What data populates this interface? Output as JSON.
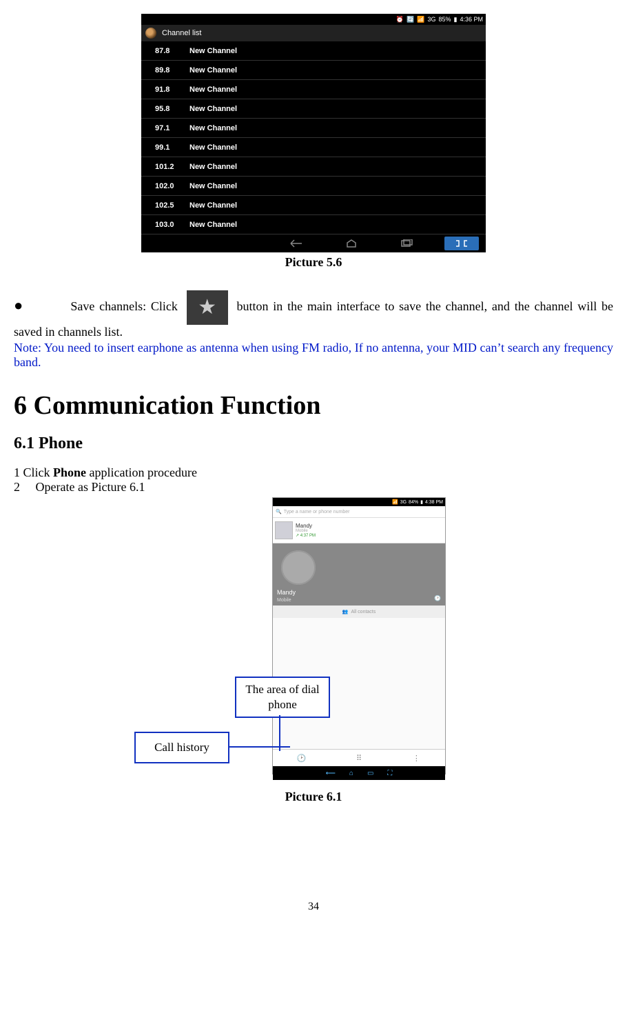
{
  "screenshot56": {
    "status": {
      "net": "3G",
      "battery": "85%",
      "time": "4:36 PM"
    },
    "title": "Channel list",
    "channels": [
      {
        "freq": "87.8",
        "name": "New Channel"
      },
      {
        "freq": "89.8",
        "name": "New Channel"
      },
      {
        "freq": "91.8",
        "name": "New Channel"
      },
      {
        "freq": "95.8",
        "name": "New Channel"
      },
      {
        "freq": "97.1",
        "name": "New Channel"
      },
      {
        "freq": "99.1",
        "name": "New Channel"
      },
      {
        "freq": "101.2",
        "name": "New Channel"
      },
      {
        "freq": "102.0",
        "name": "New Channel"
      },
      {
        "freq": "102.5",
        "name": "New Channel"
      },
      {
        "freq": "103.0",
        "name": "New Channel"
      }
    ]
  },
  "captions": {
    "p56": "Picture 5.6",
    "p61": "Picture 6.1"
  },
  "body": {
    "save_pre": "Save channels: Click ",
    "save_post": " button in the main interface to save the channel, and the channel will be saved in channels list.",
    "note": "Note: You need to insert earphone as antenna when using FM radio, If no antenna, your MID can’t search any frequency band."
  },
  "headings": {
    "h1": "6 Communication Function",
    "h2": "6.1 Phone"
  },
  "steps": {
    "s1_pre": "1 Click ",
    "s1_bold": "Phone",
    "s1_post": " application procedure",
    "s2": "2     Operate as Picture 6.1"
  },
  "pic61": {
    "status": {
      "net": "3G",
      "battery": "84%",
      "time": "4:38 PM"
    },
    "search_placeholder": "Type a name or phone number",
    "contact": {
      "name": "Mandy",
      "type": "Mobile",
      "time": "4:37 PM"
    },
    "card": {
      "name": "Mandy",
      "type": "Mobile"
    },
    "all_contacts": "All contacts",
    "icons": {
      "clock": "🕑",
      "dial": "⠿",
      "menu": "⋮"
    }
  },
  "callouts": {
    "dial": "The area of dial phone",
    "hist": "Call history"
  },
  "page": "34"
}
